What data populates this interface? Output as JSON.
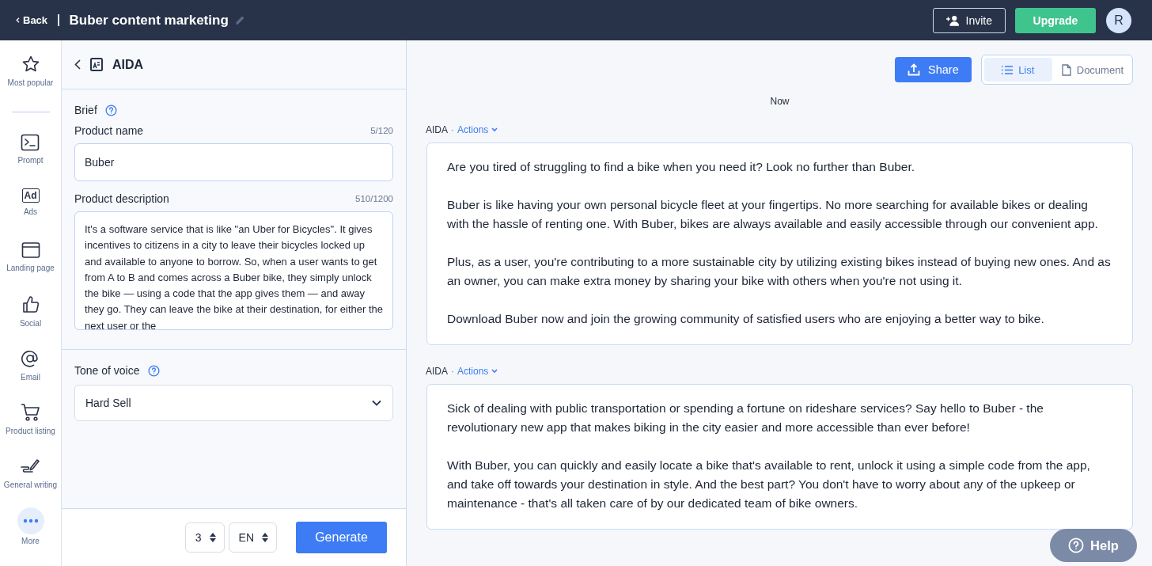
{
  "topbar": {
    "back": "Back",
    "title": "Buber content marketing",
    "invite": "Invite",
    "upgrade": "Upgrade",
    "avatar": "R"
  },
  "sidebar": {
    "items": [
      {
        "kind": "star",
        "label": "Most popular"
      },
      {
        "kind": "prompt",
        "label": "Prompt"
      },
      {
        "kind": "ad",
        "label": "Ads",
        "badge": "Ad"
      },
      {
        "kind": "window",
        "label": "Landing page"
      },
      {
        "kind": "thumb",
        "label": "Social"
      },
      {
        "kind": "at",
        "label": "Email"
      },
      {
        "kind": "cart",
        "label": "Product listing"
      },
      {
        "kind": "pen",
        "label": "General writing"
      },
      {
        "kind": "more",
        "label": "More"
      }
    ]
  },
  "brief": {
    "template": "AIDA",
    "section": "Brief",
    "fields": [
      {
        "kind": "input",
        "label": "Product name",
        "counter": "5/120",
        "value": "Buber"
      },
      {
        "kind": "textarea",
        "label": "Product description",
        "counter": "510/1200",
        "value": "It's a software service that is like \"an Uber for Bicycles\". It gives incentives to citizens in a city to leave their bicycles locked up and available to anyone to borrow. So, when a user wants to get from A to B and comes across a Buber bike, they simply unlock the bike — using a code that the app gives them — and away they go. They can leave the bike at their destination, for either the next user or the"
      }
    ],
    "tone": {
      "label": "Tone of voice",
      "value": "Hard Sell"
    },
    "footer": {
      "count": "3",
      "language": "EN",
      "generate": "Generate"
    }
  },
  "results": {
    "share": "Share",
    "views": [
      {
        "kind": "list",
        "label": "List",
        "selected": true
      },
      {
        "kind": "document",
        "label": "Document",
        "selected": false
      }
    ],
    "time": "Now",
    "outputs": [
      {
        "template": "AIDA",
        "separator": "·",
        "actions": "Actions",
        "paragraphs": [
          "Are you tired of struggling to find a bike when you need it? Look no further than Buber.",
          "Buber is like having your own personal bicycle fleet at your fingertips. No more searching for available bikes or dealing with the hassle of renting one. With Buber, bikes are always available and easily accessible through our convenient app.",
          "Plus, as a user, you're contributing to a more sustainable city by utilizing existing bikes instead of buying new ones. And as an owner, you can make extra money by sharing your bike with others when you're not using it.",
          "Download Buber now and join the growing community of satisfied users who are enjoying a better way to bike."
        ]
      },
      {
        "template": "AIDA",
        "separator": "·",
        "actions": "Actions",
        "paragraphs": [
          "Sick of dealing with public transportation or spending a fortune on rideshare services? Say hello to Buber - the revolutionary new app that makes biking in the city easier and more accessible than ever before!",
          "With Buber, you can quickly and easily locate a bike that's available to rent, unlock it using a simple code from the app, and take off towards your destination in style. And the best part? You don't have to worry about any of the upkeep or maintenance - that's all taken care of by our dedicated team of bike owners."
        ]
      }
    ]
  },
  "help": "Help"
}
